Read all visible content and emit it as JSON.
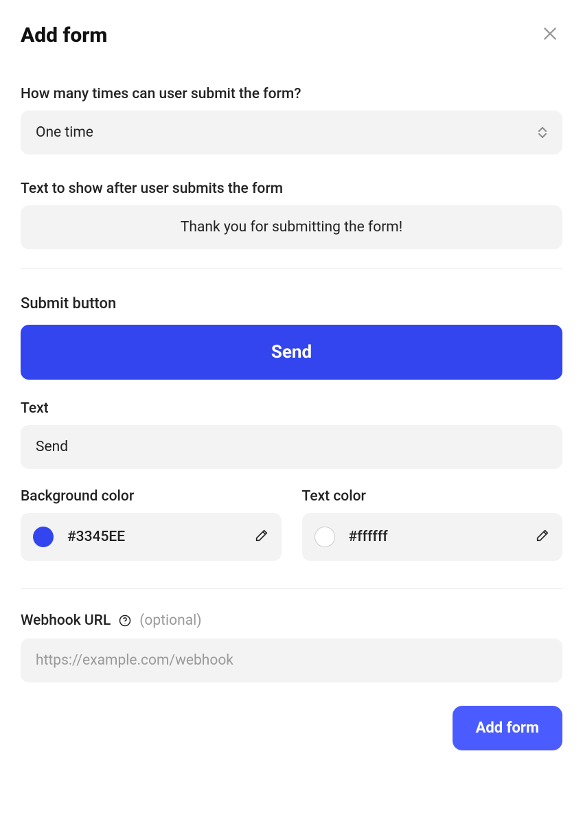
{
  "modal": {
    "title": "Add form"
  },
  "submissionLimit": {
    "label": "How many times can user submit the form?",
    "value": "One time"
  },
  "thankYou": {
    "label": "Text to show after user submits the form",
    "value": "Thank you for submitting the form!"
  },
  "submitButton": {
    "sectionLabel": "Submit button",
    "previewLabel": "Send",
    "textLabel": "Text",
    "textValue": "Send",
    "bgLabel": "Background color",
    "bgValue": "#3345EE",
    "textColorLabel": "Text color",
    "textColorValue": "#ffffff"
  },
  "webhook": {
    "label": "Webhook URL",
    "optional": "(optional)",
    "placeholder": "https://example.com/webhook",
    "value": ""
  },
  "footer": {
    "primary": "Add form"
  }
}
